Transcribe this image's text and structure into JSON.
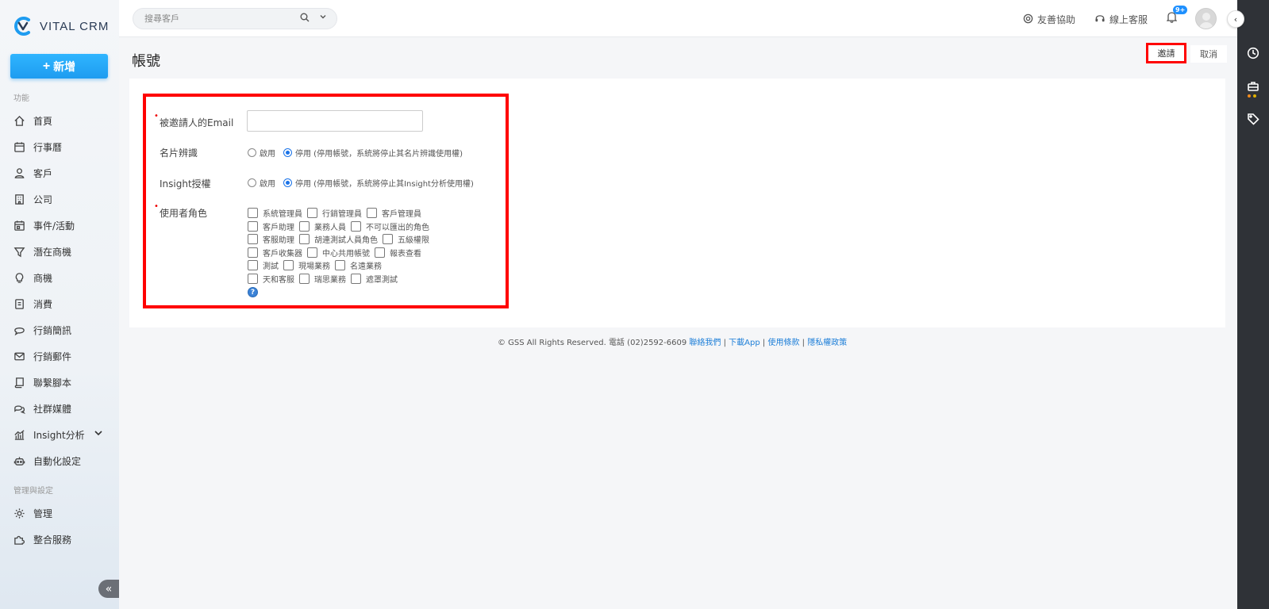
{
  "app": {
    "logo_text": "VITAL CRM"
  },
  "sidebar": {
    "add_label": "新增",
    "section_functions": "功能",
    "section_admin": "管理與設定",
    "items": [
      {
        "label": "首頁",
        "icon": "home-icon"
      },
      {
        "label": "行事曆",
        "icon": "calendar-icon"
      },
      {
        "label": "客戶",
        "icon": "user-icon"
      },
      {
        "label": "公司",
        "icon": "building-icon"
      },
      {
        "label": "事件/活動",
        "icon": "event-calendar-icon"
      },
      {
        "label": "潛在商機",
        "icon": "funnel-icon"
      },
      {
        "label": "商機",
        "icon": "lightbulb-icon"
      },
      {
        "label": "消費",
        "icon": "receipt-icon"
      },
      {
        "label": "行銷簡訊",
        "icon": "chat-icon"
      },
      {
        "label": "行銷郵件",
        "icon": "mail-icon"
      },
      {
        "label": "聯繫腳本",
        "icon": "script-icon"
      },
      {
        "label": "社群媒體",
        "icon": "social-icon"
      },
      {
        "label": "Insight分析",
        "icon": "chart-icon"
      },
      {
        "label": "自動化設定",
        "icon": "robot-icon"
      }
    ],
    "admin_items": [
      {
        "label": "管理",
        "icon": "gear-icon"
      },
      {
        "label": "整合服務",
        "icon": "puzzle-icon"
      }
    ]
  },
  "topbar": {
    "search_placeholder": "搜尋客戶",
    "help_label": "友善協助",
    "support_label": "線上客服",
    "notification_badge": "9+"
  },
  "page": {
    "title": "帳號",
    "invite_label": "邀請",
    "cancel_label": "取消"
  },
  "form": {
    "email_label": "被邀請人的Email",
    "email_value": "",
    "card_label": "名片辨識",
    "card_enable": "啟用",
    "card_disable": "停用 (停用帳號，系統將停止其名片辨識使用權)",
    "card_selected": "停用",
    "insight_label": "Insight授權",
    "insight_enable": "啟用",
    "insight_disable": "停用 (停用帳號，系統將停止其Insight分析使用權)",
    "insight_selected": "停用",
    "roles_label": "使用者角色",
    "roles": [
      [
        "系統管理員",
        "行銷管理員",
        "客戶管理員"
      ],
      [
        "客戶助理",
        "業務人員",
        "不可以匯出的角色"
      ],
      [
        "客服助理",
        "胡連測試人員角色",
        "五級權限"
      ],
      [
        "客戶收集器",
        "中心共用帳號",
        "報表查看"
      ],
      [
        "測試",
        "現場業務",
        "名遠業務"
      ],
      [
        "天和客服",
        "瑞思業務",
        "遮罩測試"
      ]
    ],
    "help_glyph": "?"
  },
  "footer": {
    "copyright": "© GSS All Rights Reserved. 電話 (02)2592-6609",
    "sep": "|",
    "contact": "聯絡我們",
    "download": "下載App",
    "terms": "使用條款",
    "privacy": "隱私權政策"
  },
  "colors": {
    "accent": "#1e9cf0",
    "highlight": "#ff0000",
    "rail": "#2f3237"
  }
}
